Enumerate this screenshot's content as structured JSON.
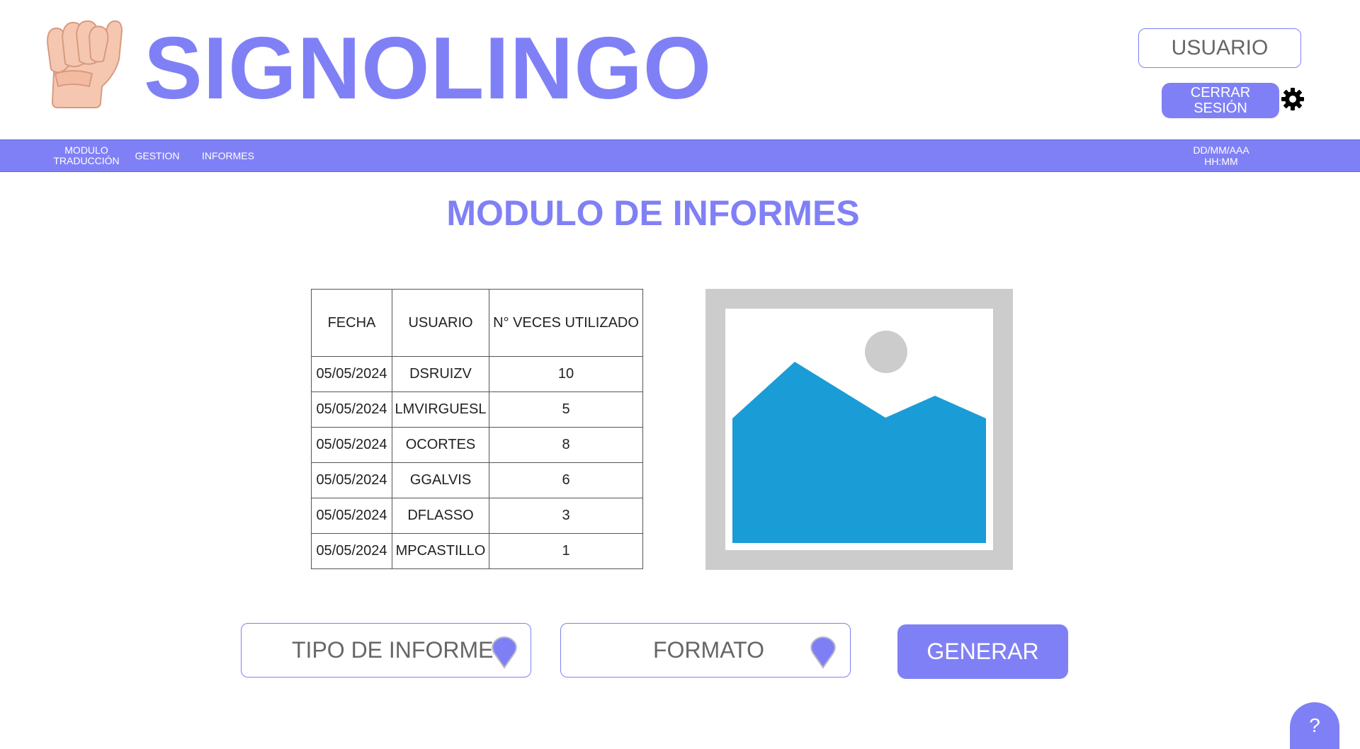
{
  "app": {
    "title": "SIGNOLINGO"
  },
  "header": {
    "user_label": "USUARIO",
    "logout_label": "CERRAR\nSESIÓN"
  },
  "nav": {
    "items": [
      {
        "label": "MODULO\nTRADUCCIÓN"
      },
      {
        "label": "GESTION"
      },
      {
        "label": "INFORMES"
      }
    ],
    "date": "DD/MM/AAA",
    "time": "HH:MM"
  },
  "main": {
    "title": "MODULO DE INFORMES",
    "table": {
      "headers": [
        "FECHA",
        "USUARIO",
        "N° VECES UTILIZADO"
      ],
      "rows": [
        [
          "05/05/2024",
          "DSRUIZV",
          "10"
        ],
        [
          "05/05/2024",
          "LMVIRGUESL",
          "5"
        ],
        [
          "05/05/2024",
          "OCORTES",
          "8"
        ],
        [
          "05/05/2024",
          "GGALVIS",
          "6"
        ],
        [
          "05/05/2024",
          "DFLASSO",
          "3"
        ],
        [
          "05/05/2024",
          "MPCASTILLO",
          "1"
        ]
      ]
    }
  },
  "controls": {
    "report_type_label": "TIPO DE INFORME",
    "format_label": "FORMATO",
    "generate_label": "GENERAR",
    "help_label": "?"
  },
  "icons": {
    "logo": "raised-fist-hand-icon",
    "settings": "gear-icon",
    "dropdown": "map-pin-icon",
    "image": "image-placeholder-icon"
  },
  "colors": {
    "accent": "#8080f6",
    "image_sky": "#1a9cd6",
    "image_frame": "#cccccc"
  }
}
